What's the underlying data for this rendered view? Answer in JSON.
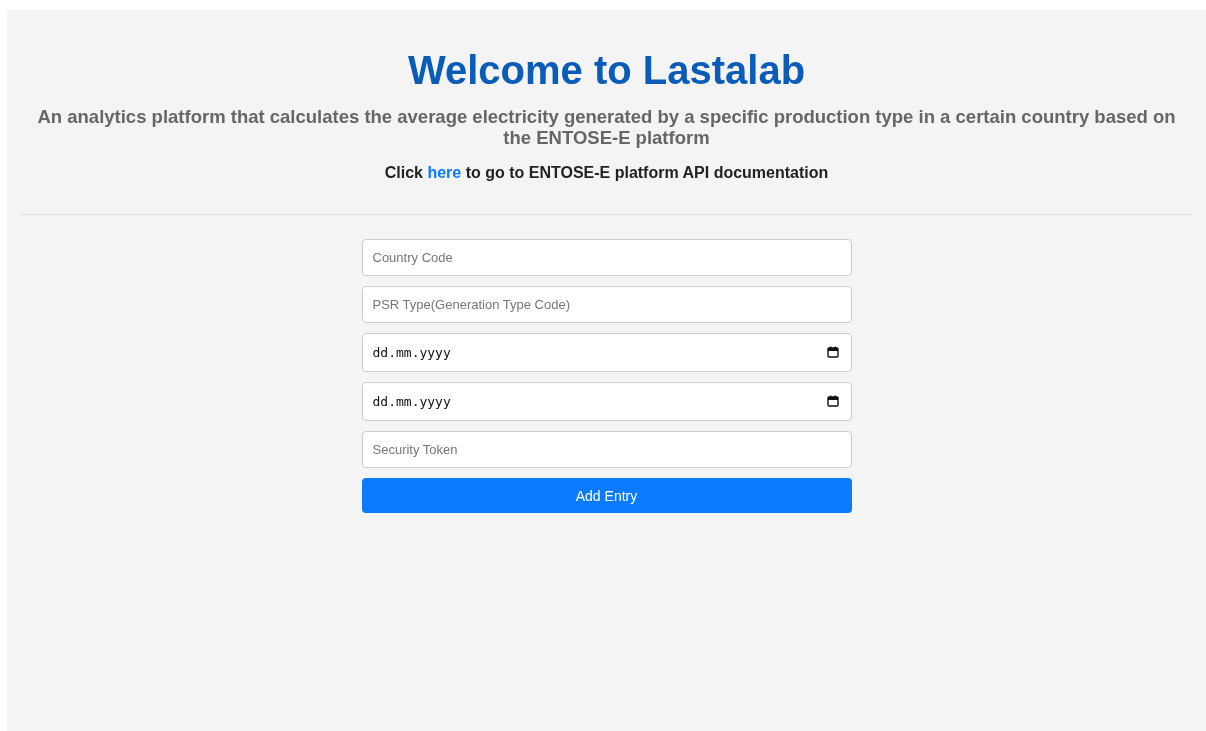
{
  "header": {
    "title": "Welcome to Lastalab",
    "subtitle": "An analytics platform that calculates the average electricity generated by a specific production type in a certain country based on the ENTOSE-E platform",
    "link_line": {
      "before": "Click",
      "link": "here",
      "after": "to go to ENTOSE-E platform API documentation"
    }
  },
  "form": {
    "fields": [
      {
        "kind": "text",
        "placeholder": "Country Code"
      },
      {
        "kind": "text",
        "placeholder": "PSR Type(Generation Type Code)"
      },
      {
        "kind": "date",
        "placeholder": "dd.mm.yyyy"
      },
      {
        "kind": "date",
        "placeholder": "dd.mm.yyyy"
      },
      {
        "kind": "text",
        "placeholder": "Security Token"
      }
    ],
    "button": "Add Entry"
  }
}
